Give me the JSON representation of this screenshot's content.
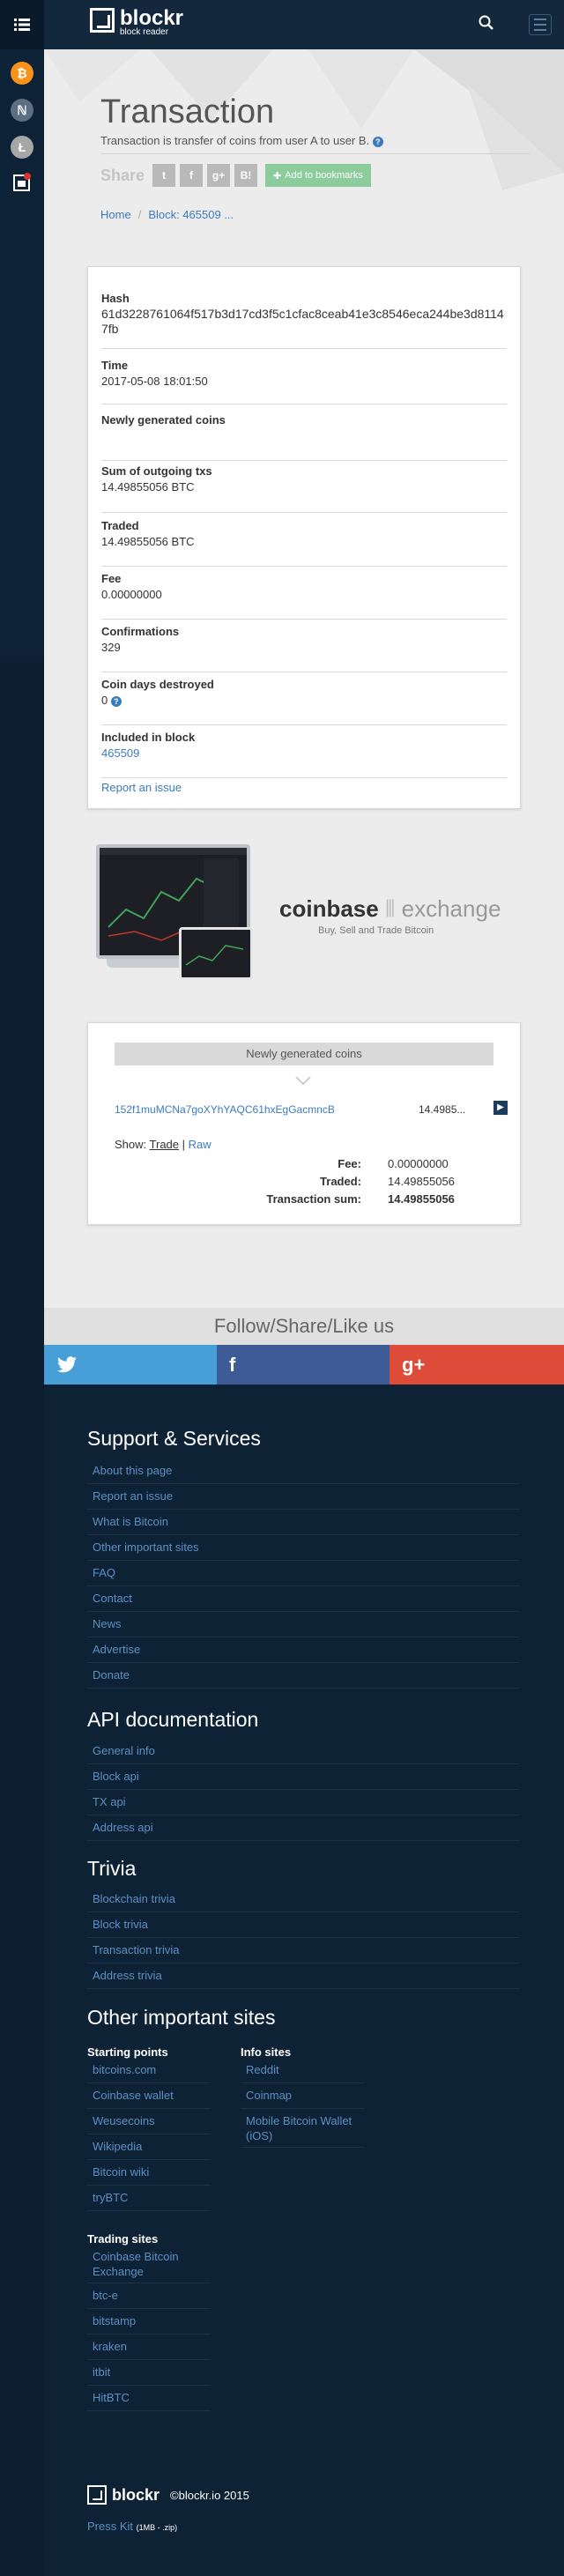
{
  "nav": {
    "brand": "blockr",
    "brand_sub": "block reader",
    "coins": [
      {
        "icon": "bitcoin-icon",
        "symbol": "₿",
        "color": "#f7931a"
      },
      {
        "icon": "namecoin-icon",
        "symbol": "ℕ",
        "color": "#5c6f82"
      },
      {
        "icon": "litecoin-icon",
        "symbol": "Ł",
        "color": "#a6a6a6"
      },
      {
        "icon": "notifications-icon",
        "symbol": "■",
        "color": "#ffffff"
      }
    ]
  },
  "hero": {
    "title": "Transaction",
    "subtitle": "Transaction is transfer of coins from user A to user B.",
    "share_label": "Share",
    "share_buttons": [
      "t",
      "f",
      "g+",
      "B!"
    ],
    "bookmark_label": "Add to bookmarks",
    "breadcrumb": {
      "home": "Home",
      "separator": "/",
      "current": "Block: 465509 ..."
    }
  },
  "transaction": {
    "hash_label": "Hash",
    "hash_value": "61d3228761064f517b3d17cd3f5c1cfac8ceab41e3c8546eca244be3d81147fb",
    "time_label": "Time",
    "time_value": "2017-05-08 18:01:50",
    "generated_label": "Newly generated coins",
    "sum_label": "Sum of outgoing txs",
    "sum_value": "14.49855056 BTC",
    "traded_label": "Traded",
    "traded_value": "14.49855056 BTC",
    "fee_label": "Fee",
    "fee_value": "0.00000000",
    "confirmations_label": "Confirmations",
    "confirmations_value": "329",
    "coin_days_label": "Coin days destroyed",
    "coin_days_value": "0",
    "block_label": "Included in block",
    "block_value": "465509",
    "report_link": "Report an issue"
  },
  "ad": {
    "brand": "coinbase",
    "brand_suffix": "exchange",
    "tagline": "Buy, Sell and Trade Bitcoin"
  },
  "outputs": {
    "header": "Newly generated coins",
    "address": "152f1muMCNa7goXYhYAQC61hxEgGacmncB",
    "amount": "14.4985...",
    "show_label": "Show:",
    "trade_link": "Trade",
    "separator": "|",
    "raw_link": "Raw",
    "fee_label": "Fee:",
    "fee_value": "0.00000000",
    "traded_label": "Traded:",
    "traded_value": "14.49855056",
    "sum_label": "Transaction sum:",
    "sum_value": "14.49855056"
  },
  "social": {
    "title": "Follow/Share/Like us",
    "twitter": "t",
    "facebook": "f",
    "googleplus": "g+"
  },
  "footer": {
    "support_title": "Support & Services",
    "support_items": [
      "About this page",
      "Report an issue",
      "What is Bitcoin",
      "Other important sites",
      "FAQ",
      "Contact",
      "News",
      "Advertise",
      "Donate"
    ],
    "api_title": "API documentation",
    "api_items": [
      "General info",
      "Block api",
      "TX api",
      "Address api"
    ],
    "trivia_title": "Trivia",
    "trivia_items": [
      "Blockchain trivia",
      "Block trivia",
      "Transaction trivia",
      "Address trivia"
    ],
    "other_title": "Other important sites",
    "starting_title": "Starting points",
    "starting_items": [
      "bitcoins.com",
      "Coinbase wallet",
      "Weusecoins",
      "Wikipedia",
      "Bitcoin wiki",
      "tryBTC"
    ],
    "info_title": "Info sites",
    "info_items": [
      "Reddit",
      "Coinmap",
      "Mobile Bitcoin Wallet (iOS)"
    ],
    "trading_title": "Trading sites",
    "trading_items": [
      "Coinbase Bitcoin Exchange",
      "btc-e",
      "bitstamp",
      "kraken",
      "itbit",
      "HitBTC"
    ],
    "brand": "blockr",
    "copyright": "©blockr.io 2015",
    "press_kit": "Press Kit",
    "press_kit_note": "(1MB - .zip)"
  }
}
